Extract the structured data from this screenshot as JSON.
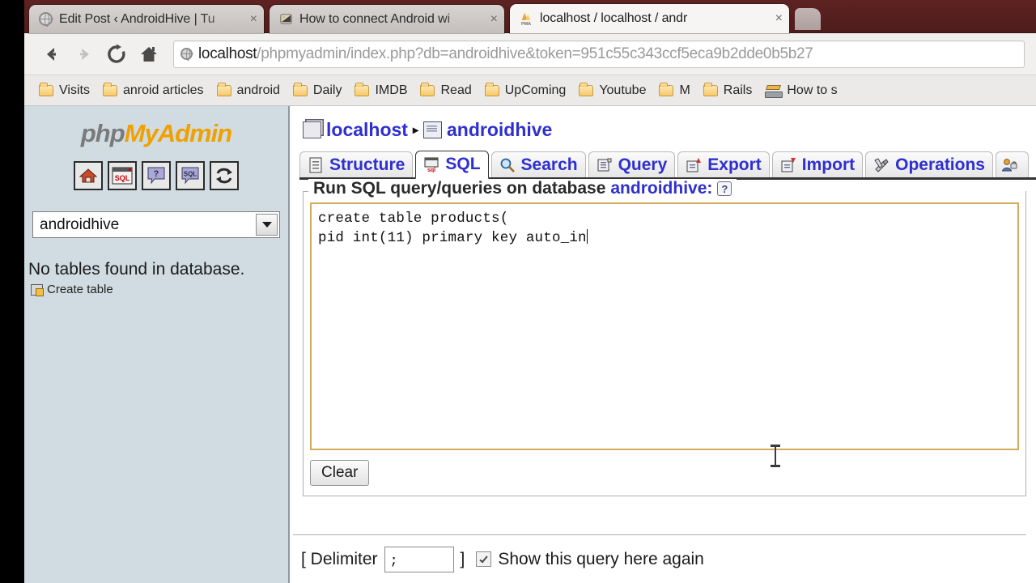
{
  "browser": {
    "tabs": [
      {
        "title": "Edit Post ‹ AndroidHive | Tu",
        "favicon": "globe-icon",
        "active": false
      },
      {
        "title": "How to connect Android wi",
        "favicon": "android-icon",
        "active": false
      },
      {
        "title": "localhost / localhost / andr",
        "favicon": "phpmyadmin-icon",
        "active": true
      }
    ],
    "close_glyph": "×",
    "nav": {
      "back": "←",
      "forward": "→",
      "reload": "⟳",
      "home": "⌂"
    },
    "url": {
      "host": "localhost",
      "path": "/phpmyadmin/index.php?db=androidhive&token=951c55c343ccf5eca9b2dde0b5b27",
      "security_icon": "globe-icon"
    },
    "bookmarks": [
      {
        "label": "Visits",
        "icon": "folder-icon"
      },
      {
        "label": "anroid articles",
        "icon": "folder-icon"
      },
      {
        "label": "android",
        "icon": "folder-icon"
      },
      {
        "label": "Daily",
        "icon": "folder-icon"
      },
      {
        "label": "IMDB",
        "icon": "folder-icon"
      },
      {
        "label": "Read",
        "icon": "folder-icon"
      },
      {
        "label": "UpComing",
        "icon": "folder-icon"
      },
      {
        "label": "Youtube",
        "icon": "folder-icon"
      },
      {
        "label": "M",
        "icon": "folder-icon"
      },
      {
        "label": "Rails",
        "icon": "folder-icon"
      },
      {
        "label": "How to s",
        "icon": "books-icon"
      }
    ]
  },
  "sidebar": {
    "logo": {
      "part1": "php",
      "part2": "MyAdmin"
    },
    "icons": [
      {
        "name": "home-icon",
        "glyph": "⌂"
      },
      {
        "name": "sql-query-window-icon",
        "glyph": "SQL"
      },
      {
        "name": "help-icon",
        "glyph": "?"
      },
      {
        "name": "sql-help-icon",
        "glyph": "SQL"
      },
      {
        "name": "reload-icon",
        "glyph": "↻"
      }
    ],
    "database_select": {
      "value": "androidhive",
      "arrow": "▼"
    },
    "no_tables_text": "No tables found in database.",
    "create_table_label": "Create table"
  },
  "content": {
    "breadcrumb": [
      {
        "label": "localhost",
        "icon": "server-icon"
      },
      {
        "label": "androidhive",
        "icon": "database-icon"
      }
    ],
    "breadcrumb_separator": "▸",
    "tabs": [
      {
        "label": "Structure",
        "icon": "structure-icon",
        "active": false
      },
      {
        "label": "SQL",
        "icon": "sql-icon",
        "active": true
      },
      {
        "label": "Search",
        "icon": "search-icon",
        "active": false
      },
      {
        "label": "Query",
        "icon": "query-icon",
        "active": false
      },
      {
        "label": "Export",
        "icon": "export-icon",
        "active": false
      },
      {
        "label": "Import",
        "icon": "import-icon",
        "active": false
      },
      {
        "label": "Operations",
        "icon": "operations-icon",
        "active": false
      },
      {
        "label": "",
        "icon": "privileges-icon",
        "active": false
      }
    ],
    "legend_prefix": "Run SQL query/queries on database",
    "legend_db": "androidhive:",
    "help_glyph": "?",
    "sql_query": "create table products(\npid int(11) primary key auto_in",
    "clear_label": "Clear",
    "footer": {
      "bracket_open": "[ Delimiter",
      "delimiter_value": ";",
      "bracket_close": "]",
      "show_query_label": "Show this query here again",
      "show_query_checked": true
    }
  },
  "colors": {
    "tabstrip": "#5e2222",
    "link": "#2f2fd0",
    "sidebar_bg": "#d0dce2",
    "textarea_border": "#d3ab5e",
    "logo_orange": "#f0a000"
  }
}
